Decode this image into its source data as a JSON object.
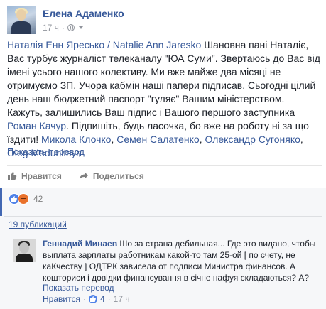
{
  "post": {
    "author": "Елена Адаменко",
    "time": "17 ч",
    "text": {
      "mention1": "Наталія Енн Яресько / Natalie Ann Jaresko",
      "part1": " Шановна пані Наталіє, Вас турбує журналіст телеканалу \"ЮА Суми\". Звертаюсь до Вас від імені усього нашого колективу. Ми вже майже два місяці не отримуємо ЗП. Учора кабмін наші папери підписав. Сьогодні цілий день наш бюджетний паспорт \"гуляє\" Вашим міністерством. Кажуть, залишились Ваш підпис і Вашого першого заступника ",
      "mention2": "Роман Качур",
      "part2": ". Підпишіть, будь ласочка, бо вже на роботу ні за що їздити! ",
      "mention3": "Микола Клочко",
      "sep1": ", ",
      "mention4": "Семен Салатенко",
      "sep2": ", ",
      "mention5": "Олександр Сугоняко",
      "sep3": ", ",
      "mention6": "Oleg Medunitsya"
    },
    "translate_label": "Показать перевод"
  },
  "actions": {
    "like_label": "Нравится",
    "share_label": "Поделиться"
  },
  "feedback": {
    "reaction_count": "42",
    "shares_label": "19 публикаций"
  },
  "comment": {
    "author": "Геннадий Минаев",
    "text": " Шо за страна дебильная... Где это видано, чтобы выплата зарплаты работникам какой-то там 25-ой [ по счету, не каКчеству ] ОДТРК зависела от подписи Министра финансов. А кошториси і довідки финансування в січне нафуя складаються? А?",
    "translate_label": "Показать перевод",
    "like_label": "Нравится",
    "separator": "·",
    "like_count": "4",
    "time": "17 ч"
  },
  "colors": {
    "link": "#365899",
    "accent": "#4267b2",
    "like_reaction": "#4f82e8",
    "angry_reaction": "#e9712b"
  }
}
